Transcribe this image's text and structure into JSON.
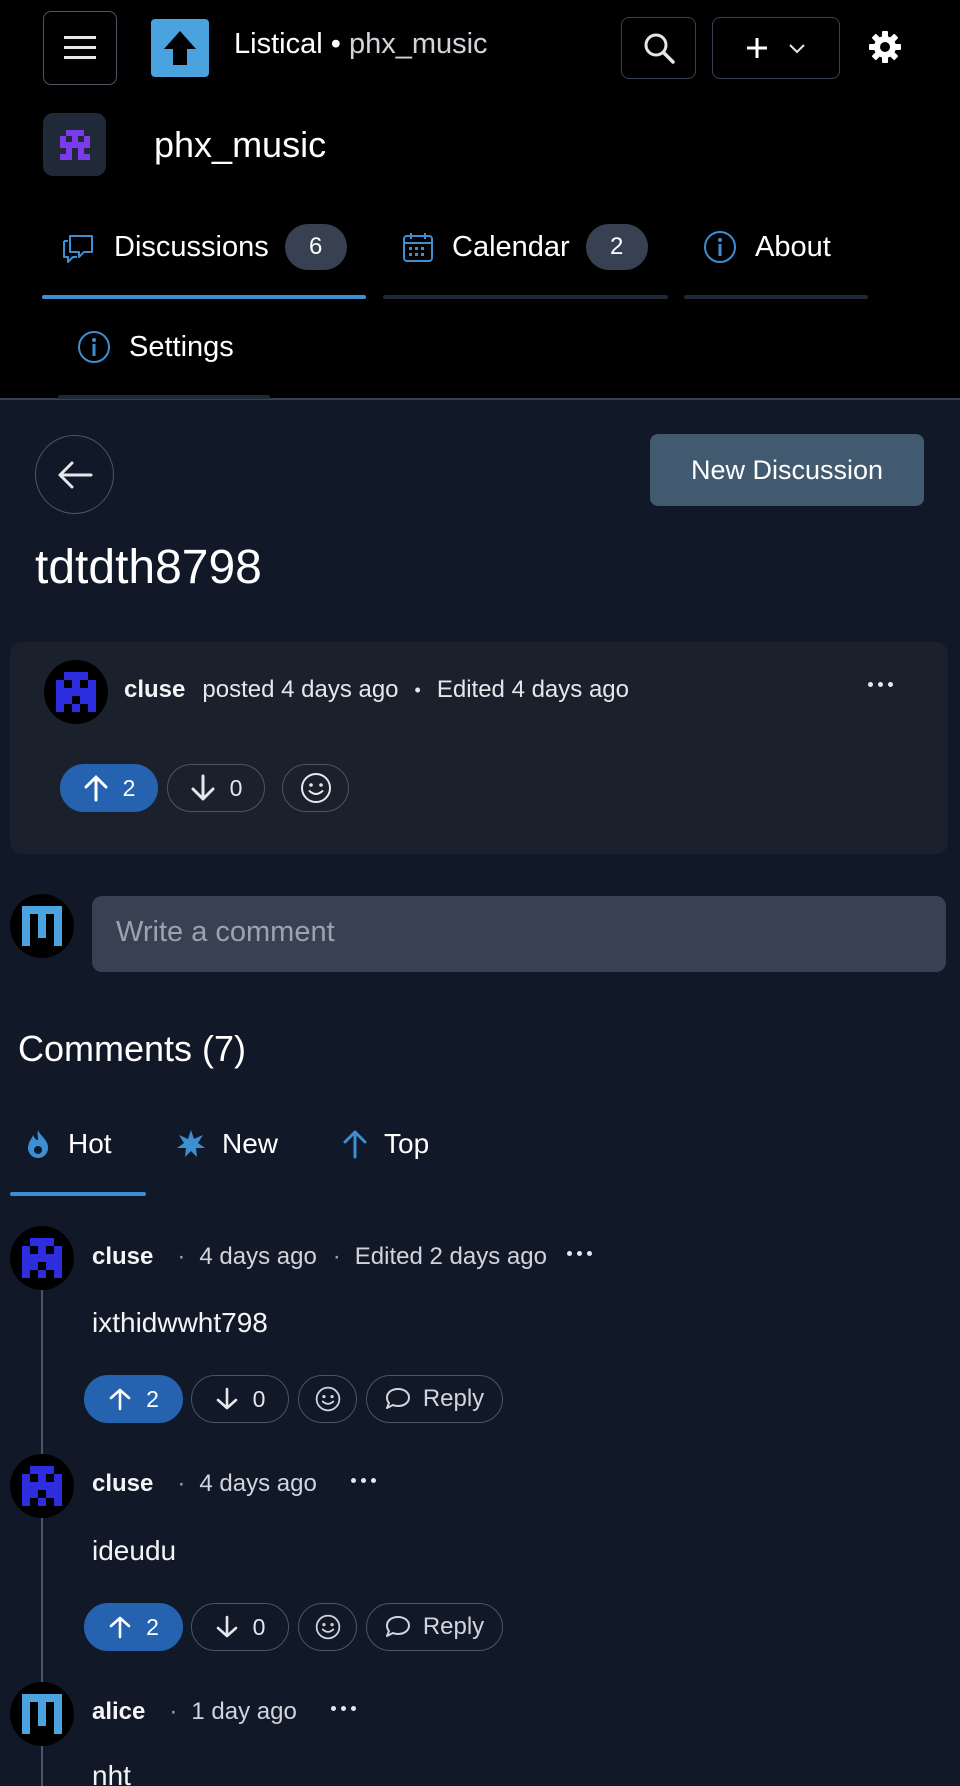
{
  "header": {
    "brand": "Listical",
    "separator": " • ",
    "forum_short": "phx_music",
    "forum_name": "phx_music"
  },
  "tabs": [
    {
      "label": "Discussions",
      "count": "6"
    },
    {
      "label": "Calendar",
      "count": "2"
    },
    {
      "label": "About"
    },
    {
      "label": "Settings"
    }
  ],
  "discussion": {
    "new_button": "New Discussion",
    "title": "tdtdth8798",
    "author": "cluse",
    "posted": "posted 4 days ago",
    "bullet": "•",
    "edited": "Edited 4 days ago",
    "upvotes": "2",
    "downvotes": "0"
  },
  "comment_box": {
    "placeholder": "Write a comment"
  },
  "comments": {
    "heading": "Comments (7)",
    "sort_tabs": [
      "Hot",
      "New",
      "Top"
    ],
    "reply_label": "Reply",
    "sep": "·",
    "items": [
      {
        "author": "cluse",
        "time": "4 days ago",
        "edited": "Edited 2 days ago",
        "body": "ixthidwwht798",
        "up": "2",
        "down": "0"
      },
      {
        "author": "cluse",
        "time": "4 days ago",
        "body": "ideudu",
        "up": "2",
        "down": "0"
      },
      {
        "author": "alice",
        "time": "1 day ago",
        "body": "nht"
      }
    ]
  },
  "colors": {
    "accent": "#3d8fd1",
    "upvote": "#2563b0",
    "logo": "#4aa3df",
    "button": "#425a6f"
  }
}
